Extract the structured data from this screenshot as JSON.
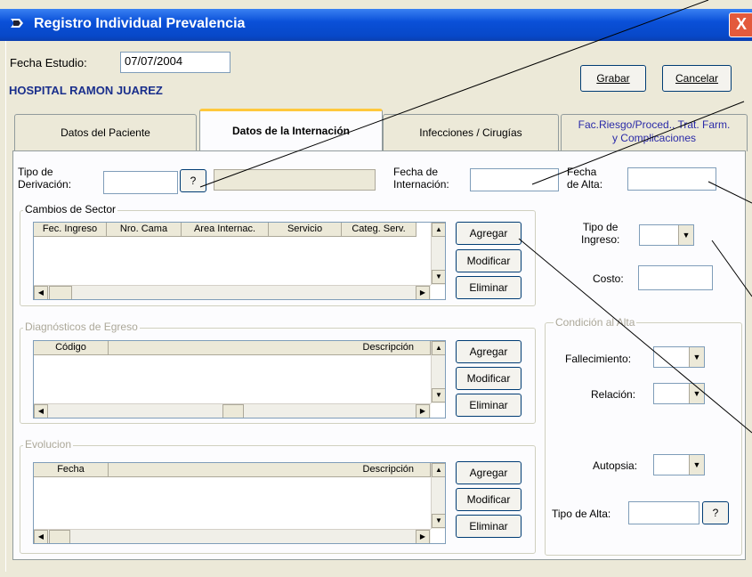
{
  "window": {
    "title": "Registro Individual Prevalencia",
    "close_label": "X"
  },
  "header": {
    "fecha_estudio_label": "Fecha Estudio:",
    "fecha_estudio_value": "07/07/2004",
    "hospital": "HOSPITAL RAMON JUAREZ",
    "grabar": "Grabar",
    "cancelar": "Cancelar"
  },
  "tabs": [
    {
      "label": "Datos del Paciente"
    },
    {
      "label": "Datos de la Internación"
    },
    {
      "label": "Infecciones / Cirugías"
    },
    {
      "label_line1": "Fac.Riesgo/Proced., Trat. Farm.",
      "label_line2": "y Complicaciones"
    }
  ],
  "form": {
    "tipo_derivacion_l1": "Tipo de",
    "tipo_derivacion_l2": "Derivación:",
    "lookup_btn": "?",
    "fecha_internacion_l1": "Fecha de",
    "fecha_internacion_l2": "Internación:",
    "fecha_alta_l1": "Fecha",
    "fecha_alta_l2": "de Alta:",
    "tipo_ingreso_l1": "Tipo de",
    "tipo_ingreso_l2": "Ingreso:",
    "costo": "Costo:"
  },
  "cambios_sector": {
    "title": "Cambios de Sector",
    "columns": [
      "Fec. Ingreso",
      "Nro. Cama",
      "Area Internac.",
      "Servicio",
      "Categ. Serv."
    ]
  },
  "diagnosticos": {
    "title": "Diagnósticos de Egreso",
    "columns": [
      "Código",
      "Descripción"
    ]
  },
  "evolucion": {
    "title": "Evolucion",
    "columns": [
      "Fecha",
      "Descripción"
    ]
  },
  "buttons": {
    "agregar": "Agregar",
    "modificar": "Modificar",
    "eliminar": "Eliminar"
  },
  "condicion_alta": {
    "title": "Condición al Alta",
    "fallecimiento": "Fallecimiento:",
    "relacion": "Relación:",
    "autopsia": "Autopsia:",
    "tipo_alta": "Tipo de Alta:",
    "lookup_btn": "?"
  },
  "icons": {
    "window": "pencil-arrow-icon",
    "dropdown": "chevron-down-icon"
  },
  "colors": {
    "titlebar": "#0a50d8",
    "hospital_text": "#1a2f8c",
    "active_tab_accent": "#ffc83c"
  }
}
